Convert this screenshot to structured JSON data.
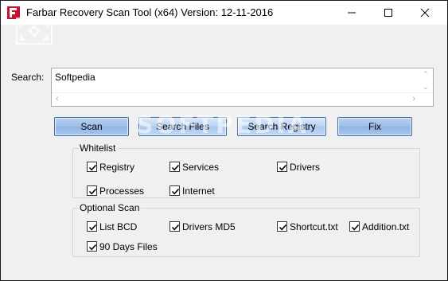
{
  "window": {
    "title": "Farbar Recovery Scan Tool (x64) Version: 12-11-2016",
    "icon": "frst-app-icon",
    "controls": [
      "minimize-icon",
      "maximize-icon",
      "close-icon"
    ]
  },
  "search": {
    "label": "Search:",
    "value": "Softpedia"
  },
  "buttons": {
    "scan": "Scan",
    "search_files": "Search Files",
    "search_registry": "Search Registry",
    "fix": "Fix"
  },
  "whitelist": {
    "title": "Whitelist",
    "items": [
      {
        "label": "Registry",
        "checked": true
      },
      {
        "label": "Services",
        "checked": true
      },
      {
        "label": "Drivers",
        "checked": true
      },
      {
        "label": "Processes",
        "checked": true
      },
      {
        "label": "Internet",
        "checked": true
      }
    ]
  },
  "optional_scan": {
    "title": "Optional Scan",
    "items": [
      {
        "label": "List BCD",
        "checked": true
      },
      {
        "label": "Drivers MD5",
        "checked": true
      },
      {
        "label": "Shortcut.txt",
        "checked": true
      },
      {
        "label": "Addition.txt",
        "checked": true
      },
      {
        "label": "90 Days Files",
        "checked": true
      }
    ]
  },
  "watermark": "SOFTPEDIA",
  "colors": {
    "button_border": "#3a6ea5",
    "button_fill": "#b7d1f3",
    "button_fill_dark": "#9ebfea",
    "window_bg": "#f0f0f0",
    "icon_red": "#c8102e"
  }
}
